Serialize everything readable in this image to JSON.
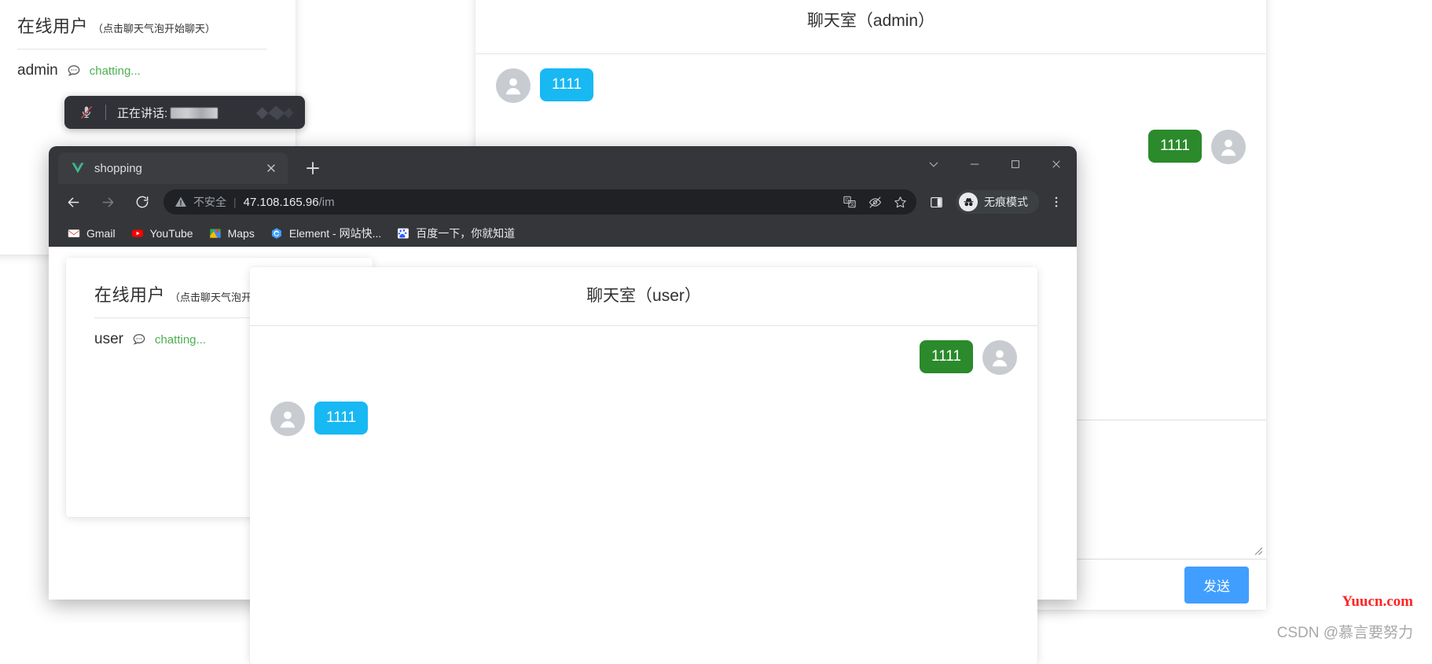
{
  "admin_panel": {
    "users_title": "在线用户",
    "users_subtitle": "（点击聊天气泡开始聊天）",
    "user_name": "admin",
    "user_status": "chatting...",
    "chat_icon": "chat-bubble-icon"
  },
  "speaking_toast": {
    "mic_icon": "microphone-muted-icon",
    "label": "正在讲话:",
    "redacted_name": "",
    "logo_icon": "chevron-logo-icon"
  },
  "admin_chat": {
    "title": "聊天室（admin）",
    "messages": [
      {
        "side": "in",
        "avatar": "user-avatar",
        "text": "1111"
      },
      {
        "side": "out",
        "avatar": "user-avatar",
        "text": "1111"
      }
    ],
    "input_value": "",
    "input_placeholder": "",
    "send_label": "发送"
  },
  "browser": {
    "tab": {
      "favicon": "vue-logo-icon",
      "title": "shopping",
      "close_icon": "close-icon"
    },
    "new_tab_icon": "plus-icon",
    "window_controls": [
      {
        "name": "tab-search-button",
        "icon": "chevron-down-icon"
      },
      {
        "name": "minimize-button",
        "icon": "minimize-icon"
      },
      {
        "name": "maximize-button",
        "icon": "maximize-icon"
      },
      {
        "name": "close-window-button",
        "icon": "close-icon"
      }
    ],
    "nav": {
      "back_icon": "arrow-left-icon",
      "forward_icon": "arrow-right-icon",
      "reload_icon": "reload-icon"
    },
    "omnibox": {
      "warning_icon": "warning-triangle-icon",
      "insecure_label": "不安全",
      "separator": "|",
      "url_host": "47.108.165.96",
      "url_path": "/im",
      "actions": [
        {
          "name": "translate-button",
          "icon": "translate-icon"
        },
        {
          "name": "hide-password-button",
          "icon": "eye-off-icon"
        },
        {
          "name": "bookmark-button",
          "icon": "star-icon"
        }
      ]
    },
    "side_panel_icon": "side-panel-icon",
    "incognito": {
      "icon": "incognito-icon",
      "label": "无痕模式"
    },
    "menu_icon": "kebab-menu-icon",
    "bookmarks": [
      {
        "icon": "gmail-icon",
        "label": "Gmail"
      },
      {
        "icon": "youtube-icon",
        "label": "YouTube"
      },
      {
        "icon": "maps-icon",
        "label": "Maps"
      },
      {
        "icon": "element-icon",
        "label": "Element - 网站快..."
      },
      {
        "icon": "baidu-icon",
        "label": "百度一下，你就知道"
      }
    ]
  },
  "user_panel": {
    "users_title": "在线用户",
    "users_subtitle": "（点击聊天气泡开始聊",
    "user_name": "user",
    "user_status": "chatting...",
    "chat_icon": "chat-bubble-icon"
  },
  "user_chat": {
    "title": "聊天室（user）",
    "messages": [
      {
        "side": "out",
        "avatar": "user-avatar",
        "text": "1111"
      },
      {
        "side": "in",
        "avatar": "user-avatar",
        "text": "1111"
      }
    ]
  },
  "watermarks": {
    "red": "Yuucn.com",
    "gray": "CSDN @慕言要努力"
  },
  "colors": {
    "bubble_in": "#18b8f3",
    "bubble_out": "#2b8a2b",
    "send_button": "#409eff",
    "status_green": "#4caf50",
    "chrome_bg": "#35363a",
    "omnibox_bg": "#202124",
    "watermark_red": "#ff2424"
  }
}
